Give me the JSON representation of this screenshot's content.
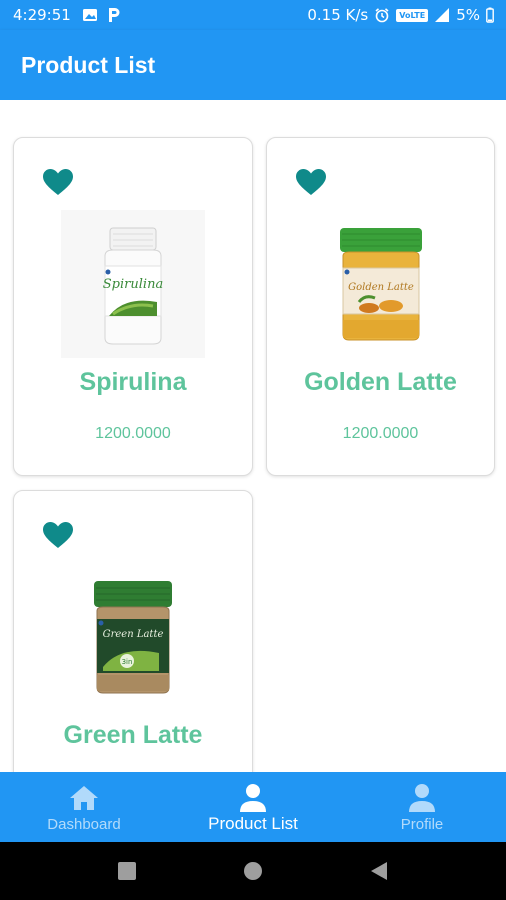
{
  "status_bar": {
    "time": "4:29:51",
    "network_speed": "0.15 K/s",
    "volte": "VoLTE",
    "battery": "5%"
  },
  "app_bar": {
    "title": "Product List"
  },
  "products": [
    {
      "name": "Spirulina",
      "price": "1200.0000",
      "image_icon": "spirulina-bottle"
    },
    {
      "name": "Golden Latte",
      "price": "1200.0000",
      "image_icon": "golden-latte-jar"
    },
    {
      "name": "Green Latte",
      "price": "",
      "image_icon": "green-latte-jar"
    }
  ],
  "bottom_nav": {
    "items": [
      {
        "label": "Dashboard",
        "icon": "home-icon",
        "active": false
      },
      {
        "label": "Product List",
        "icon": "person-icon",
        "active": true
      },
      {
        "label": "Profile",
        "icon": "person-icon",
        "active": false
      }
    ]
  },
  "colors": {
    "primary": "#2196f3",
    "product_text": "#5ec49c",
    "favorite": "#0f8a8a"
  }
}
